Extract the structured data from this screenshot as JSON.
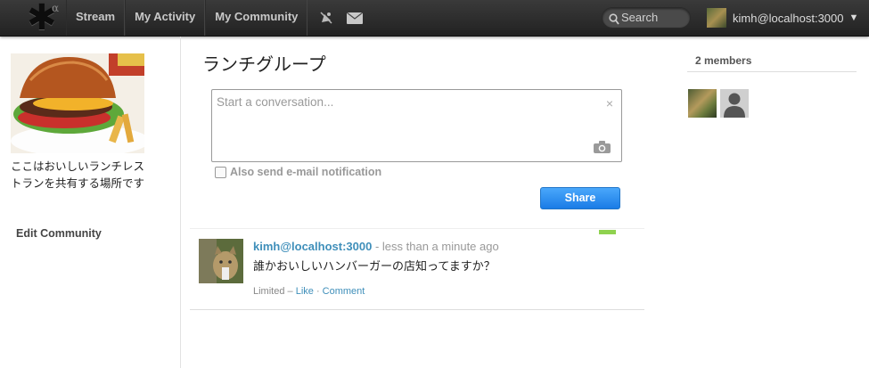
{
  "nav": {
    "logo_alpha": "α",
    "items": [
      "Stream",
      "My Activity",
      "My Community"
    ],
    "search_placeholder": "Search",
    "user": "kimh@localhost:3000",
    "user_caret": "▼"
  },
  "sidebar": {
    "description": "ここはおいしいランチレストランを共有する場所です",
    "edit_link": "Edit Community"
  },
  "main": {
    "title": "ランチグループ",
    "composer_placeholder": "Start a conversation...",
    "composer_close": "×",
    "notify_label": "Also send e-mail notification",
    "share_label": "Share"
  },
  "post": {
    "author": "kimh@localhost:3000",
    "time": "less than a minute ago",
    "separator": " - ",
    "message": "誰かおいしいハンバーガーの店知ってますか？",
    "visibility": "Limited",
    "dash": " – ",
    "like": "Like",
    "dot": " · ",
    "comment": "Comment"
  },
  "members": {
    "title": "2 members"
  },
  "colors": {
    "topbar": "#2b2b2b",
    "link": "#3f8fba",
    "share_button": "#2a8cf0",
    "green_marker": "#8fd24f"
  }
}
